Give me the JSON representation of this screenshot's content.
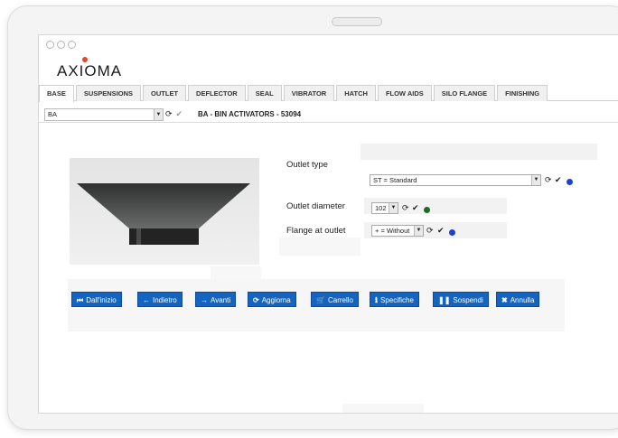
{
  "app": {
    "logo": "AXIOMA"
  },
  "tabs": [
    {
      "label": "BASE",
      "active": true
    },
    {
      "label": "SUSPENSIONS"
    },
    {
      "label": "OUTLET"
    },
    {
      "label": "DEFLECTOR"
    },
    {
      "label": "SEAL"
    },
    {
      "label": "VIBRATOR"
    },
    {
      "label": "HATCH"
    },
    {
      "label": "FLOW AIDS"
    },
    {
      "label": "SILO FLANGE"
    },
    {
      "label": "FINISHING"
    }
  ],
  "subbar": {
    "selected": "BA",
    "refresh_icon": "refresh-icon",
    "check_icon": "check-icon",
    "product_title": "BA - BIN ACTIVATORS - 53094"
  },
  "form": {
    "outlet_type": {
      "label": "Outlet type",
      "value": "ST = Standard",
      "status_color": "#1e3fd6"
    },
    "outlet_diameter": {
      "label": "Outlet diameter",
      "value": "102",
      "status_color": "#1d6b2a"
    },
    "flange_at_outlet": {
      "label": "Flange at outlet",
      "value": "+ = Without",
      "status_color": "#1e3fd6"
    }
  },
  "buttons": [
    {
      "label": "Dall'inizio",
      "icon": "first-icon"
    },
    {
      "label": "Indietro",
      "icon": "back-arrow-icon"
    },
    {
      "label": "Avanti",
      "icon": "forward-arrow-icon"
    },
    {
      "label": "Aggiorna",
      "icon": "refresh-icon"
    },
    {
      "label": "Carrello",
      "icon": "cart-icon"
    },
    {
      "label": "Specifiche",
      "icon": "info-icon"
    },
    {
      "label": "Sospendi",
      "icon": "pause-icon"
    },
    {
      "label": "Annulla",
      "icon": "close-icon"
    }
  ],
  "colors": {
    "button_blue": "#1565c0",
    "logo_accent": "#e8452c"
  }
}
